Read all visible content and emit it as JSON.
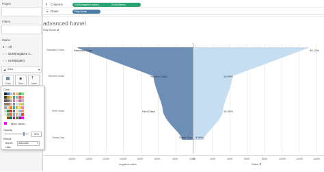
{
  "shelves": {
    "pages_label": "Pages",
    "columns_label": "Columns",
    "rows_label": "Rows",
    "columns_pills": [
      "SUM(negative sales )",
      "SUM(Sales)"
    ],
    "rows_pill": "Ship Mode"
  },
  "left": {
    "filters_label": "Filters",
    "marks_label": "Marks",
    "marks_items": [
      "All",
      "SUM(negative s...",
      "SUM(Sales)"
    ],
    "mark_type": "Area",
    "buttons": [
      "Color",
      "Size",
      "Label"
    ]
  },
  "color_popup": {
    "title": "Color",
    "more_colors": "More colors...",
    "opacity_label": "Opacity",
    "opacity_value": "80%",
    "effects_label": "Effects",
    "border_label": "Border:",
    "border_value": "Automatic",
    "halo_label": "Halo:"
  },
  "sheet": {
    "title": "advanced funnel",
    "row_header": "Ship Mode"
  },
  "chart_data": {
    "type": "area",
    "title": "advanced funnel",
    "categories": [
      "Standard Class",
      "Second Class",
      "First Class",
      "Same Day"
    ],
    "series": [
      {
        "name": "negative sales",
        "color": "#6e8fb5",
        "values": [
          -1340000,
          -460000,
          -350000,
          -130000
        ]
      },
      {
        "name": "Sales",
        "color": "#c6def2",
        "values": [
          1340000,
          460000,
          350000,
          130000
        ]
      }
    ],
    "pct_labels": [
      "59.12%",
      "19.99%",
      "15.30%",
      "5.59%"
    ],
    "left_axis_ticks": [
      "1600K",
      "1400K",
      "1200K",
      "1000K",
      "800K",
      "600K",
      "400K",
      "200K",
      "0K"
    ],
    "right_axis_ticks": [
      "0K",
      "200K",
      "400K",
      "600K",
      "800K",
      "1000K",
      "1200K",
      "1400K"
    ],
    "left_axis_title": "negative sales",
    "right_axis_title": "Sales",
    "xlim": [
      -1600000,
      1400000
    ]
  }
}
